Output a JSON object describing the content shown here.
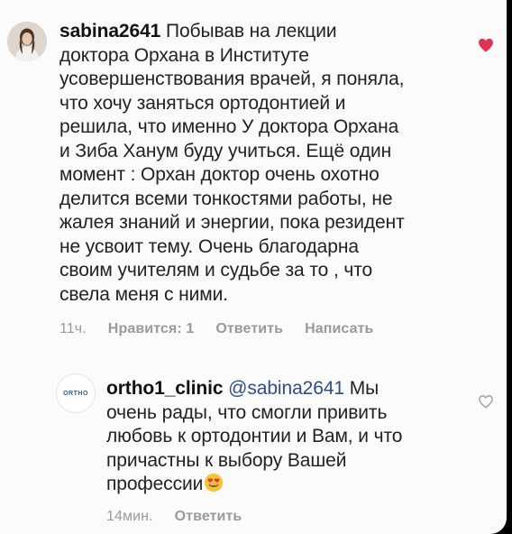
{
  "comment": {
    "username": "sabina2641",
    "text": " Побывав на лекции\nдоктора Орхана в Институте\nусовершенствования врачей, я поняла,\nчто хочу заняться ортодонтией и\nрешила, что именно У доктора Орхана\nи Зиба  Ханум буду учиться. Ещё один\nмомент : Орхан доктор очень охотно\nделится всеми тонкостями работы, не\nжалея знаний и энергии, пока резидент\nне усвоит тему. Очень благодарна\nсвоим учителям и судьбе за то , что\nсвела меня с ними.",
    "time": "11ч.",
    "likes": "Нравится: 1",
    "reply": "Ответить",
    "message": "Написать",
    "liked_color": "#e0334f"
  },
  "reply": {
    "avatar_text": "ORTHO",
    "username": "ortho1_clinic",
    "mention": "@sabina2641",
    "text": " Мы\nочень рады, что смогли привить\nлюбовь к ортодонтии и Вам, и что\nпричастны к выбору Вашей\nпрофессии",
    "emoji": "heart-eyes-emoji",
    "time": "14мин.",
    "reply": "Ответить"
  }
}
